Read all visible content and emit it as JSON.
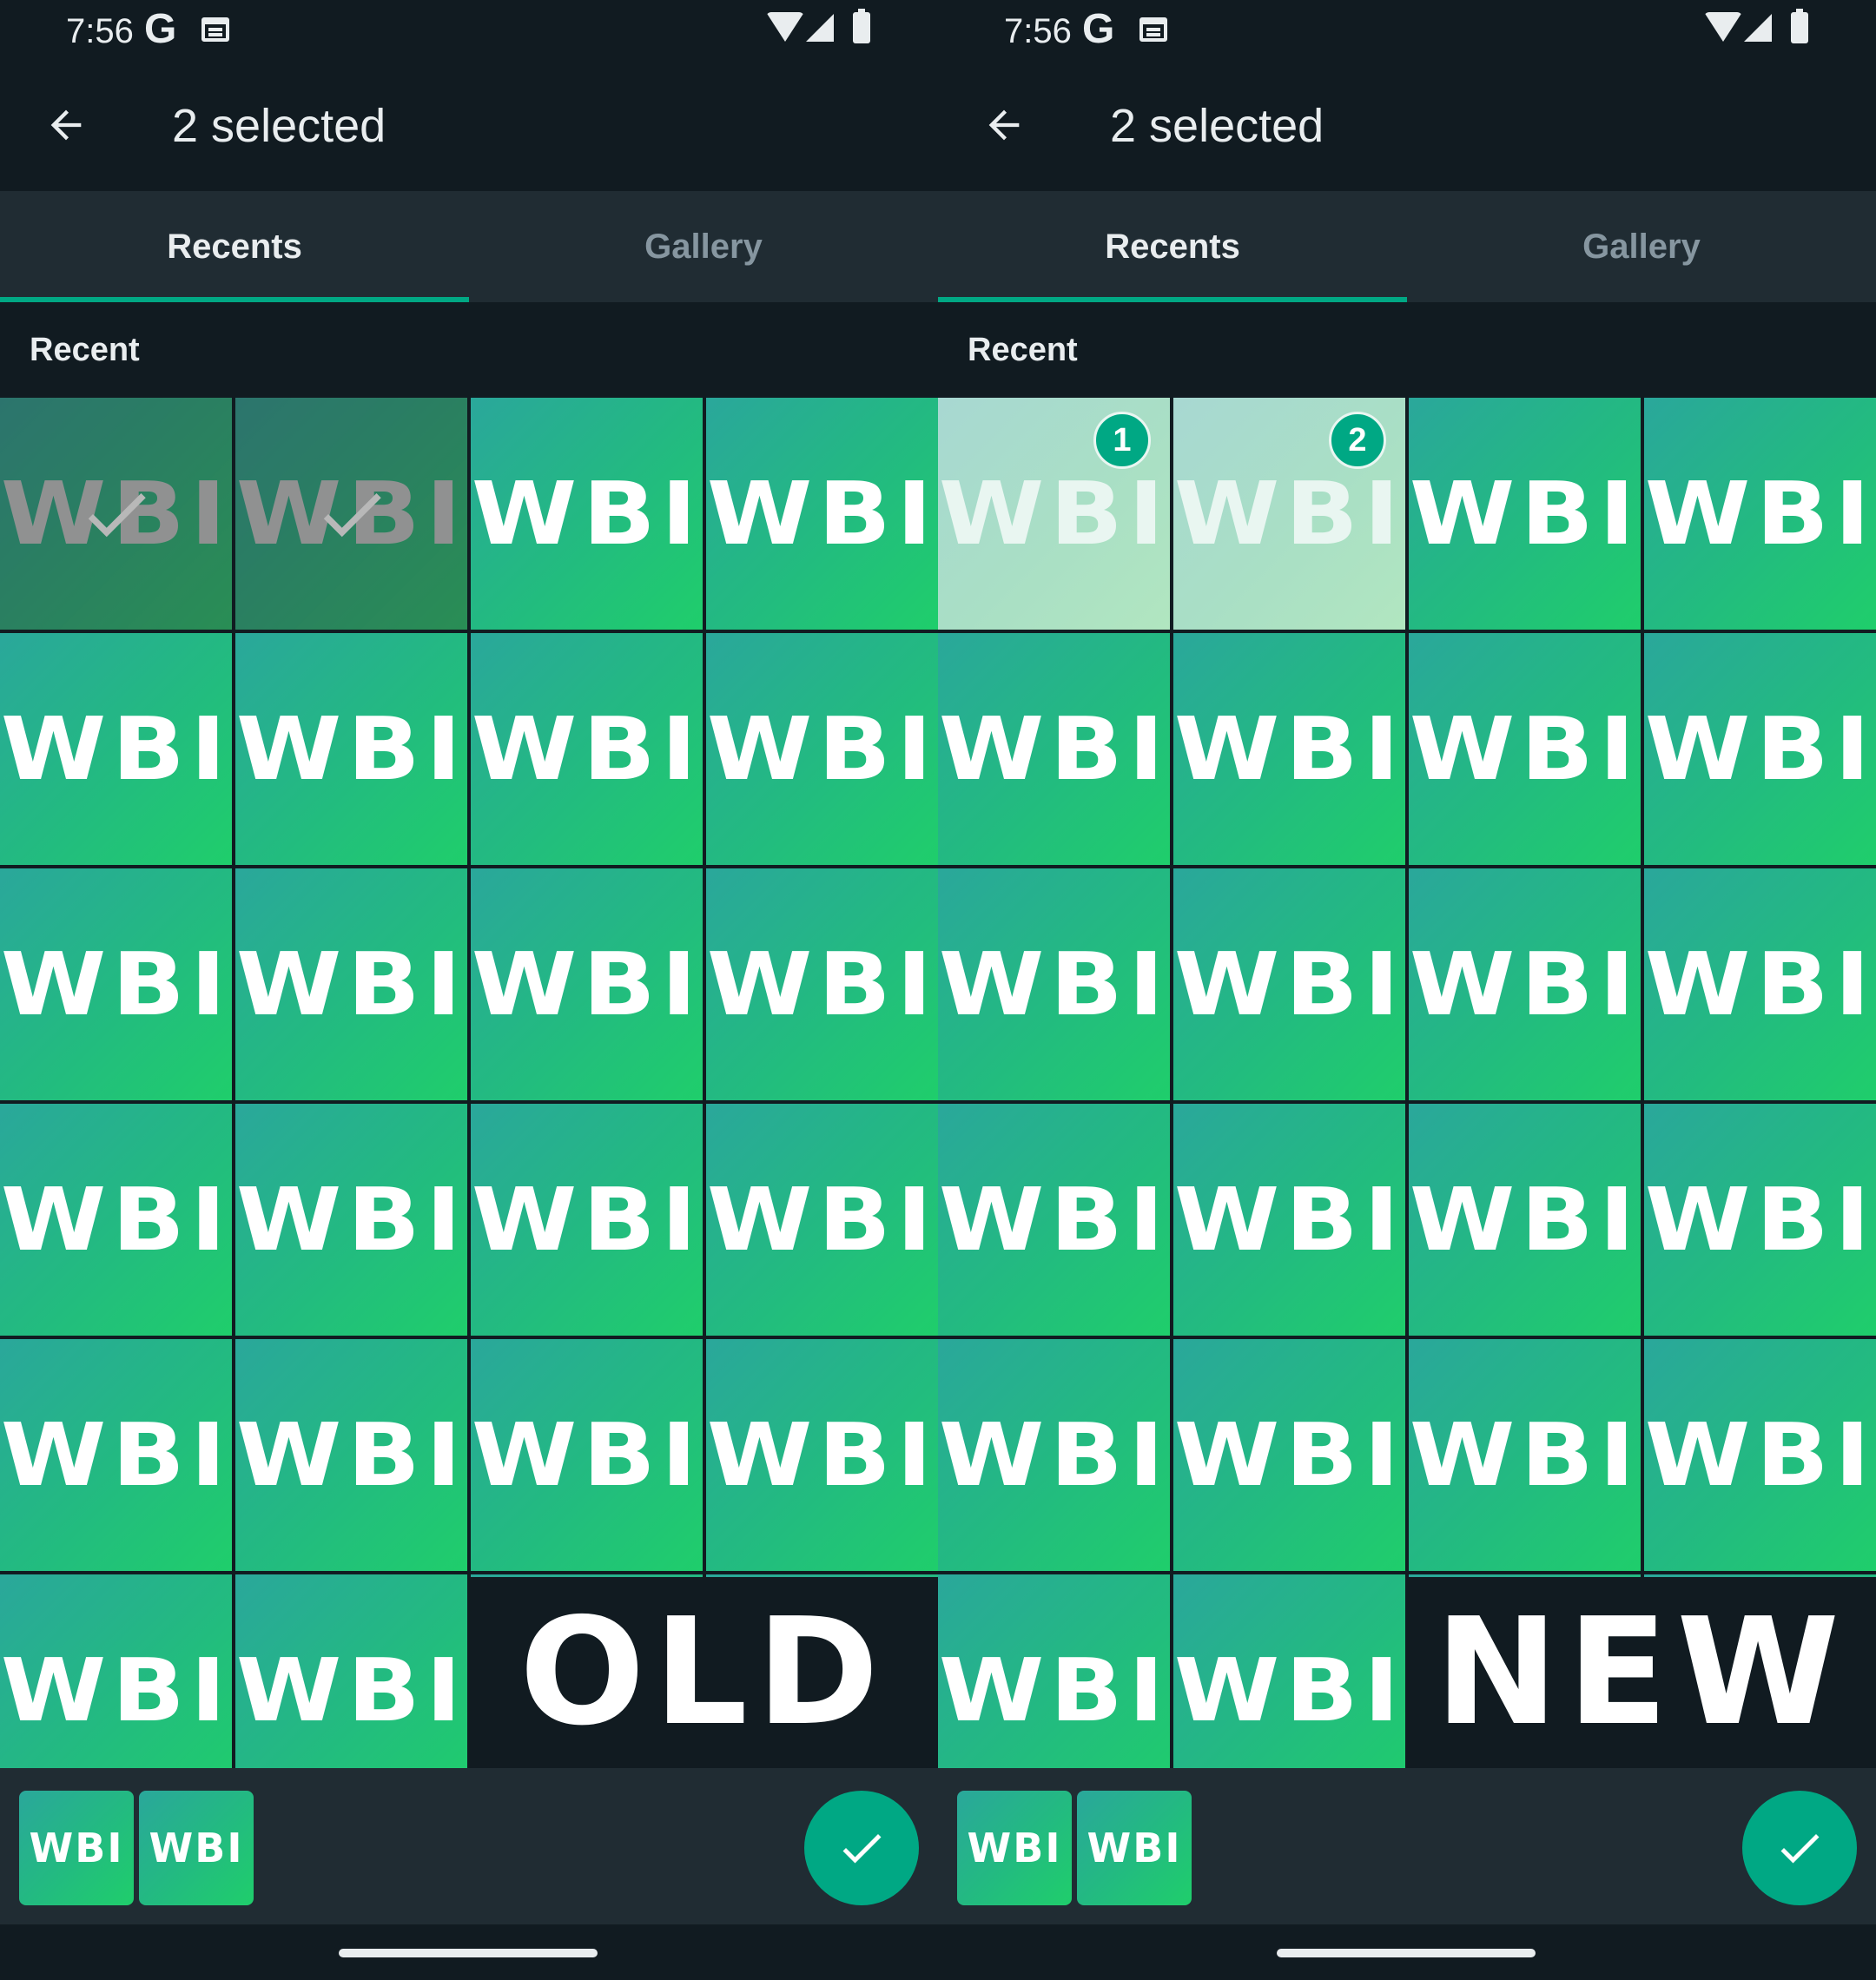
{
  "panels": [
    {
      "variant": "old",
      "status": {
        "time": "7:56",
        "google": "G"
      },
      "title": "2 selected",
      "tabs": [
        "Recents",
        "Gallery"
      ],
      "active_tab": 0,
      "section_label": "Recent",
      "tile_label": "WBI",
      "selected_tiles": [
        0,
        1
      ],
      "selection_style": "checkmark",
      "version_label": "OLD",
      "thumbnails": [
        "WBI",
        "WBI"
      ]
    },
    {
      "variant": "new",
      "status": {
        "time": "7:56",
        "google": "G"
      },
      "title": "2 selected",
      "tabs": [
        "Recents",
        "Gallery"
      ],
      "active_tab": 0,
      "section_label": "Recent",
      "tile_label": "WBI",
      "selected_tiles": [
        0,
        1
      ],
      "selection_badges": [
        "1",
        "2"
      ],
      "selection_style": "numbered",
      "version_label": "NEW",
      "thumbnails": [
        "WBI",
        "WBI"
      ]
    }
  ],
  "colors": {
    "background": "#111b21",
    "bar": "#202c33",
    "accent": "#00a884",
    "tile_gradient_start": "#2aa79b",
    "tile_gradient_end": "#1fce6b"
  },
  "icons": {
    "back": "arrow-left-icon",
    "send": "check-icon",
    "selected": "check-icon"
  }
}
